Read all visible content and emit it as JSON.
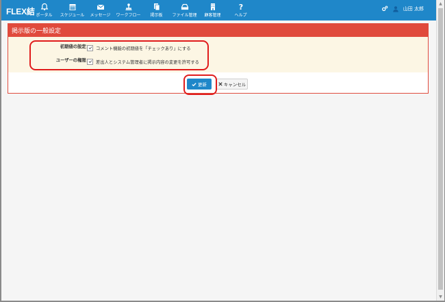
{
  "app": {
    "logo": "FLEX結",
    "nav": [
      {
        "label": "ポータル",
        "icon": "bell-icon"
      },
      {
        "label": "スケジュール",
        "icon": "calendar-icon"
      },
      {
        "label": "メッセージ",
        "icon": "envelope-icon"
      },
      {
        "label": "ワークフロー",
        "icon": "workflow-icon"
      },
      {
        "label": "掲示板",
        "icon": "bulletin-icon"
      },
      {
        "label": "ファイル管理",
        "icon": "drive-icon"
      },
      {
        "label": "顧客管理",
        "icon": "building-icon"
      },
      {
        "label": "ヘルプ",
        "icon": "question-icon"
      }
    ],
    "user_name": "山田 太郎"
  },
  "panel": {
    "title": "掲示版の一般設定",
    "settings": [
      {
        "label": "初期値の設定：",
        "option": "コメント機能の初期値を「チェックあり」にする",
        "checked": true
      },
      {
        "label": "ユーザーの権限：",
        "option": "差出人とシステム管理者に掲示内容の変更を許可する",
        "checked": true
      }
    ],
    "update_label": "更新",
    "cancel_label": "キャンセル"
  },
  "colors": {
    "header": "#1f87c9",
    "panel_header": "#e04a3c",
    "highlight": "#e01b1b"
  }
}
